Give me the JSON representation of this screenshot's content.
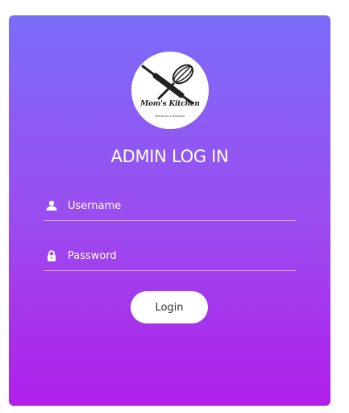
{
  "logo": {
    "title": "Mom's Kitchen",
    "tagline": "dornecs a dremes"
  },
  "heading": "ADMIN LOG IN",
  "form": {
    "username_placeholder": "Username",
    "username_icon": "user-icon",
    "password_placeholder": "Password",
    "password_icon": "lock-icon",
    "login_label": "Login"
  },
  "colors": {
    "gradient_top": "#7b6cf8",
    "gradient_bottom": "#b01fe9",
    "text": "#ffffff"
  }
}
